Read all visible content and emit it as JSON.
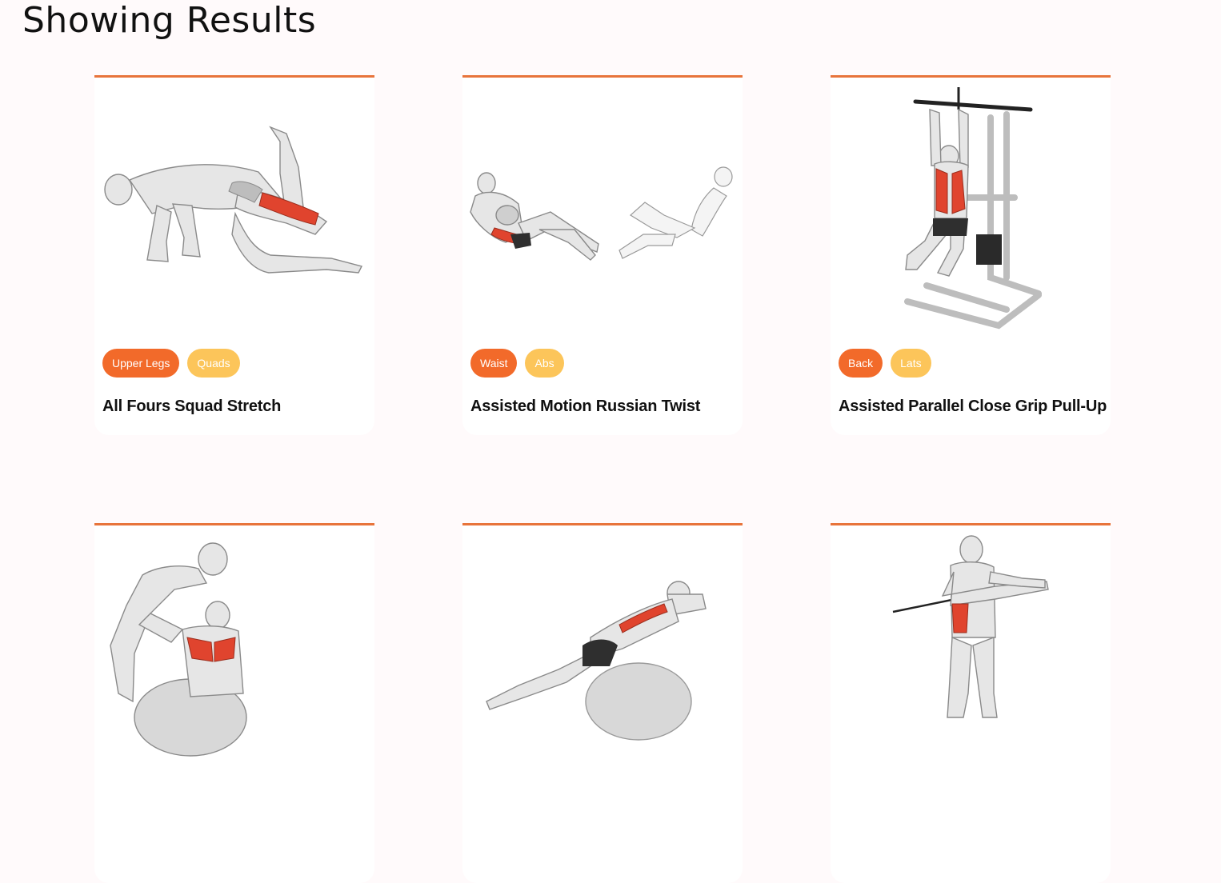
{
  "page": {
    "heading": "Showing Results"
  },
  "colors": {
    "accent": "#e8743b",
    "primary_pill": "#f26a2a",
    "secondary_pill": "#fcc55a",
    "muscle_highlight": "#e0442e"
  },
  "exercises": [
    {
      "title": "All Fours Squad Stretch",
      "body_part": "Upper Legs",
      "target": "Quads",
      "illustration": "all-fours-squad-stretch-illustration"
    },
    {
      "title": "Assisted Motion Russian Twist",
      "body_part": "Waist",
      "target": "Abs",
      "illustration": "russian-twist-illustration"
    },
    {
      "title": "Assisted Parallel Close Grip Pull-Up",
      "body_part": "Back",
      "target": "Lats",
      "illustration": "pull-up-machine-illustration"
    },
    {
      "title": "",
      "body_part": "",
      "target": "",
      "illustration": "assisted-chest-stretch-ball-illustration"
    },
    {
      "title": "",
      "body_part": "",
      "target": "",
      "illustration": "ball-back-extension-illustration"
    },
    {
      "title": "",
      "body_part": "",
      "target": "",
      "illustration": "cable-standing-rotation-illustration"
    }
  ]
}
